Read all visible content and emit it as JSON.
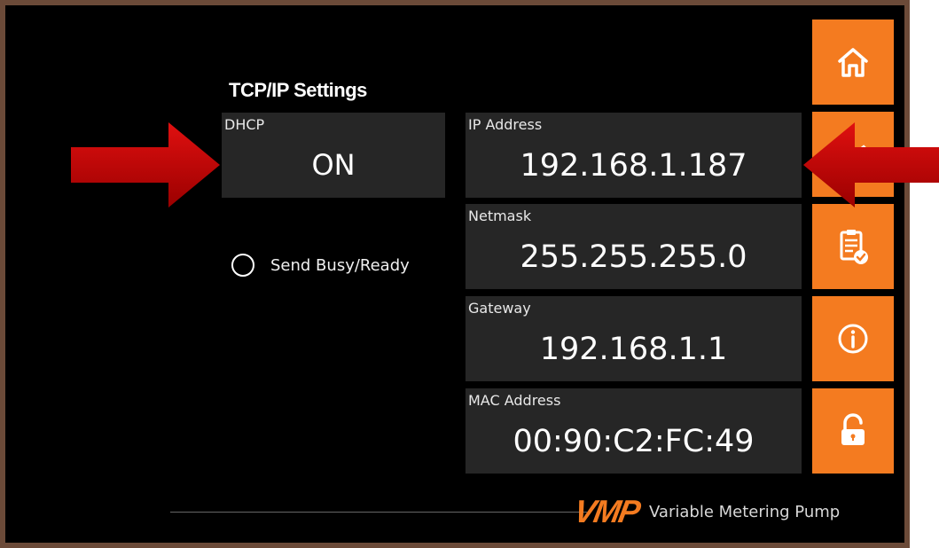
{
  "header": {
    "title": "TCP/IP Settings"
  },
  "fields": {
    "dhcp": {
      "label": "DHCP",
      "value": "ON"
    },
    "ip_address": {
      "label": "IP Address",
      "value": "192.168.1.187"
    },
    "netmask": {
      "label": "Netmask",
      "value": "255.255.255.0"
    },
    "gateway": {
      "label": "Gateway",
      "value": "192.168.1.1"
    },
    "mac_address": {
      "label": "MAC Address",
      "value": "00:90:C2:FC:49"
    }
  },
  "options": {
    "send_busy_ready": {
      "label": "Send Busy/Ready",
      "checked": false
    }
  },
  "sidebar": {
    "buttons": [
      {
        "icon": "home-icon"
      },
      {
        "icon": "network-icon"
      },
      {
        "icon": "clipboard-check-icon"
      },
      {
        "icon": "info-icon"
      },
      {
        "icon": "unlock-icon"
      }
    ]
  },
  "footer": {
    "logo": "VMP",
    "product_name": "Variable Metering Pump"
  },
  "colors": {
    "accent": "#f47b20",
    "panel": "#262626",
    "background": "#000000",
    "arrow": "#c00000"
  }
}
